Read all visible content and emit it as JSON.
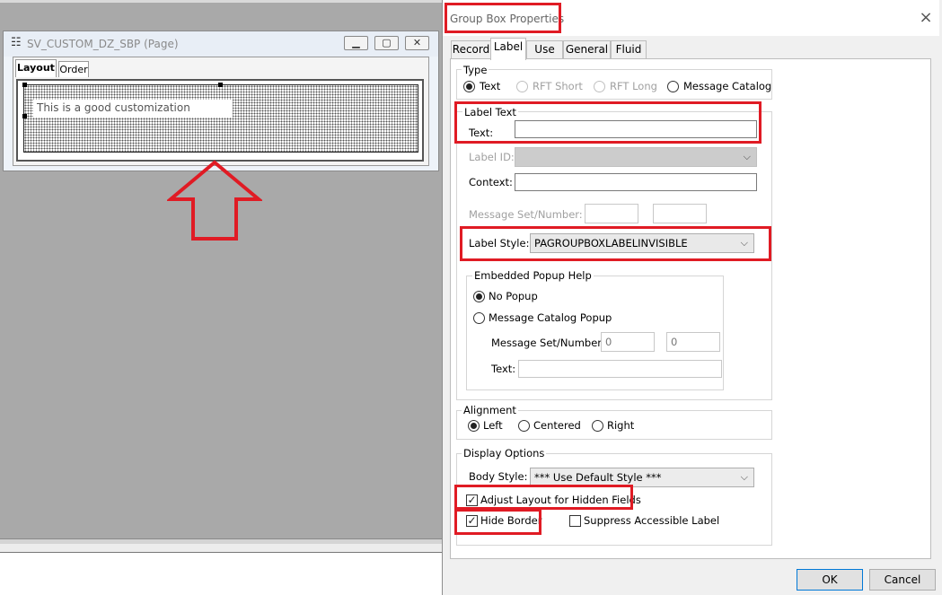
{
  "designer": {
    "window_title": "SV_CUSTOM_DZ_SBP (Page)",
    "window_icon": "page-icon",
    "tabs": [
      {
        "label": "Layout"
      },
      {
        "label": "Order"
      }
    ],
    "groupbox_text": "This is a good customization"
  },
  "dialog": {
    "title": "Group Box Properties",
    "close_icon": "close-icon",
    "tabs": [
      {
        "label": "Record"
      },
      {
        "label": "Label",
        "active": true
      },
      {
        "label": "Use"
      },
      {
        "label": "General"
      },
      {
        "label": "Fluid"
      }
    ],
    "type_group": {
      "legend": "Type",
      "options": [
        {
          "label": "Text",
          "checked": true
        },
        {
          "label": "RFT Short",
          "disabled": true
        },
        {
          "label": "RFT Long",
          "disabled": true
        },
        {
          "label": "Message Catalog"
        }
      ]
    },
    "label_text_group": {
      "legend": "Label Text",
      "text_label": "Text:",
      "text_value": "",
      "label_id_label": "Label ID:",
      "context_label": "Context:",
      "context_value": "",
      "message_set_label": "Message Set/Number:",
      "message_set_value": "",
      "message_number_value": "",
      "label_style_label": "Label Style:",
      "label_style_value": "PAGROUPBOXLABELINVISIBLE"
    },
    "popup_group": {
      "legend": "Embedded Popup Help",
      "no_popup": "No Popup",
      "message_catalog_popup": "Message Catalog Popup",
      "message_set_label": "Message Set/Number:",
      "message_set_value": "0",
      "message_number_value": "0",
      "text_label": "Text:",
      "text_value": ""
    },
    "alignment_group": {
      "legend": "Alignment",
      "options": [
        {
          "label": "Left",
          "checked": true
        },
        {
          "label": "Centered"
        },
        {
          "label": "Right"
        }
      ]
    },
    "display_group": {
      "legend": "Display Options",
      "body_style_label": "Body Style:",
      "body_style_value": "*** Use Default Style ***",
      "adjust_layout": "Adjust Layout for Hidden Fields",
      "hide_border": "Hide Border",
      "suppress_label": "Suppress Accessible Label"
    },
    "buttons": {
      "ok": "OK",
      "cancel": "Cancel"
    }
  },
  "annotation_color": "#e01b24"
}
